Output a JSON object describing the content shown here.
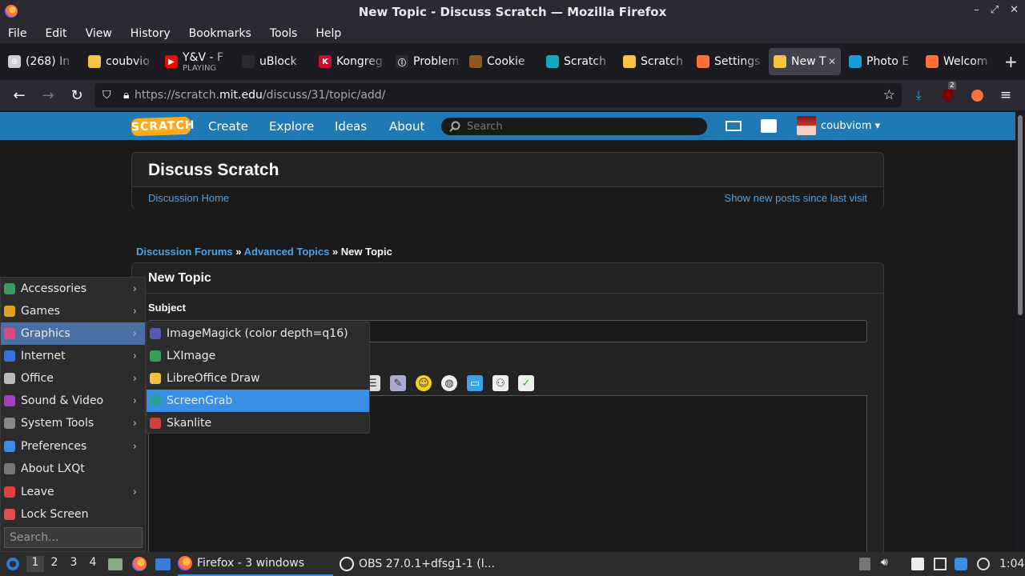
{
  "window": {
    "title": "New Topic - Discuss Scratch — Mozilla Firefox",
    "controls": [
      "–",
      "⤢",
      "✕"
    ]
  },
  "menubar": [
    "File",
    "Edit",
    "View",
    "History",
    "Bookmarks",
    "Tools",
    "Help"
  ],
  "tabs": [
    {
      "label": "(268) In",
      "color": "#cfcfd8",
      "glyph": "⊙"
    },
    {
      "label": "coubvio",
      "color": "#f5c542",
      "glyph": ""
    },
    {
      "label": "Y&V - F",
      "sub": "PLAYING",
      "color": "#ff0000",
      "glyph": "▶"
    },
    {
      "label": "uBlock",
      "color": "#2b2a33",
      "glyph": ""
    },
    {
      "label": "Kongreg",
      "color": "#c8102e",
      "glyph": "K"
    },
    {
      "label": "Problem",
      "color": "#2b2a33",
      "glyph": "ⓘ"
    },
    {
      "label": "Cookie",
      "color": "#8b5a2b",
      "glyph": ""
    },
    {
      "label": "Scratch",
      "color": "#1ab",
      "glyph": ""
    },
    {
      "label": "Scratch",
      "color": "#f5c542",
      "glyph": ""
    },
    {
      "label": "Settings",
      "color": "#ff7139",
      "glyph": ""
    },
    {
      "label": "New T",
      "color": "#f5c542",
      "glyph": "",
      "active": true,
      "close": "✕"
    },
    {
      "label": "Photo E",
      "color": "#1a9ad6",
      "glyph": ""
    },
    {
      "label": "Welcom",
      "color": "#ff7139",
      "glyph": ""
    }
  ],
  "newtab": "+",
  "nav": {
    "back": "←",
    "forward": "→",
    "reload": "↻",
    "url_prefix": "https://scratch.",
    "url_domain": "mit.edu",
    "url_path": "/discuss/31/topic/add/",
    "star": "☆",
    "download_count": "2"
  },
  "scratch": {
    "logo": "SCRATCH",
    "nav": [
      "Create",
      "Explore",
      "Ideas",
      "About"
    ],
    "search_placeholder": "Search",
    "username": "coubviom ▾"
  },
  "discuss": {
    "title": "Discuss Scratch",
    "home_link": "Discussion Home",
    "new_posts_link": "Show new posts since last visit"
  },
  "breadcrumb": {
    "forums": "Discussion Forums",
    "sep": " » ",
    "advanced": "Advanced Topics",
    "current": "New Topic"
  },
  "form": {
    "heading": "New Topic",
    "subject_label": "Subject"
  },
  "lxqt_menu": {
    "items": [
      {
        "label": "Accessories",
        "submenu": true,
        "color": "#3a9d5d"
      },
      {
        "label": "Games",
        "submenu": true,
        "color": "#e0a020"
      },
      {
        "label": "Graphics",
        "submenu": true,
        "color": "#d94a8c",
        "selected": true
      },
      {
        "label": "Internet",
        "submenu": true,
        "color": "#3a6fd9"
      },
      {
        "label": "Office",
        "submenu": true,
        "color": "#bbbbbb"
      },
      {
        "label": "Sound & Video",
        "submenu": true,
        "color": "#a040c0"
      },
      {
        "label": "System Tools",
        "submenu": true,
        "color": "#888888"
      },
      {
        "label": "Preferences",
        "submenu": true,
        "color": "#3a8ee6"
      },
      {
        "label": "About LXQt",
        "submenu": false,
        "color": "#777777"
      },
      {
        "label": "Leave",
        "submenu": true,
        "color": "#e04040"
      },
      {
        "label": "Lock Screen",
        "submenu": false,
        "color": "#e05050"
      }
    ],
    "search_placeholder": "Search..."
  },
  "graphics_submenu": [
    {
      "label": "ImageMagick (color depth=q16)",
      "color": "#5a5ab0"
    },
    {
      "label": "LXImage",
      "color": "#3a9d5d"
    },
    {
      "label": "LibreOffice Draw",
      "color": "#f0c040"
    },
    {
      "label": "ScreenGrab",
      "color": "#2aa198",
      "selected": true
    },
    {
      "label": "Skanlite",
      "color": "#d04040"
    }
  ],
  "taskbar": {
    "desktops": [
      "1",
      "2",
      "3",
      "4"
    ],
    "tasks": [
      "Firefox - 3 windows",
      "OBS 27.0.1+dfsg1-1 (l..."
    ],
    "clock": "1:04"
  }
}
